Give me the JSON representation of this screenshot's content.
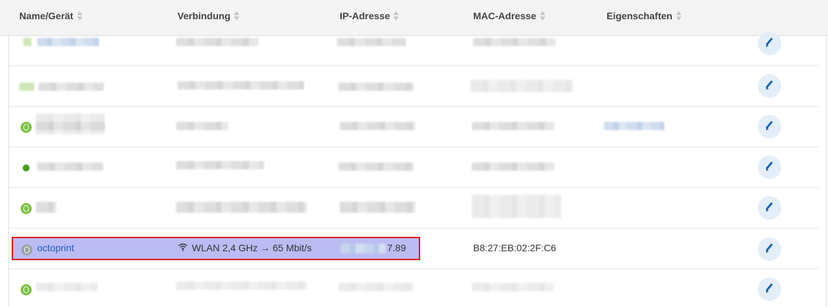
{
  "table": {
    "columns": [
      {
        "label": "Name/Gerät"
      },
      {
        "label": "Verbindung"
      },
      {
        "label": "IP-Adresse"
      },
      {
        "label": "MAC-Adresse"
      },
      {
        "label": "Eigenschaften"
      }
    ],
    "highlighted_row": {
      "name": "octoprint",
      "connection": "WLAN 2,4 GHz → 65 Mbit/s",
      "ip_visible_suffix": "7.89",
      "mac": "B8:27:EB:02:2F:C6"
    }
  },
  "colors": {
    "highlight_fill": "#bcbcf4",
    "highlight_border": "#e01818",
    "link": "#1b5fb8",
    "online_green": "#7cc142",
    "edit_button_bg": "#e3eef8"
  },
  "icons": [
    "globe-icon",
    "status-dot-icon",
    "wifi-icon",
    "sort-icon",
    "pencil-icon"
  ]
}
